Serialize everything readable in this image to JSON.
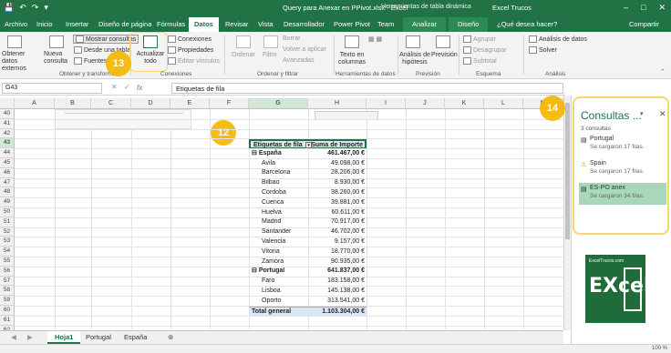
{
  "window": {
    "title": "Query para Anexar en PPivot.xlsx - Excel",
    "context_tools": "Herramientas de tabla dinámica",
    "user": "Excel Trucos"
  },
  "tabs": [
    "Archivo",
    "Inicio",
    "Insertar",
    "Diseño de página",
    "Fórmulas",
    "Datos",
    "Revisar",
    "Vista",
    "Desarrollador",
    "Power Pivot",
    "Team",
    "Analizar",
    "Diseño",
    "¿Qué desea hacer?",
    "Compartir"
  ],
  "ribbon": {
    "obtener": {
      "btn1": "Obtener datos externos",
      "btn2": "Nueva consulta",
      "items": [
        "Mostrar consultas",
        "Desde una tabla",
        "Fuentes"
      ],
      "label": "Obtener y transformar"
    },
    "conexiones": {
      "refresh": "Actualizar todo",
      "items": [
        "Conexiones",
        "Propiedades",
        "Editar vínculos"
      ],
      "label": "Conexiones"
    },
    "ordenar": {
      "sort": "Ordenar",
      "filter": "Filtro",
      "items": [
        "Borrar",
        "Volver a aplicar",
        "Avanzadas"
      ],
      "label": "Ordenar y filtrar"
    },
    "herramientas": {
      "btn": "Texto en columnas",
      "label": "Herramientas de datos"
    },
    "prevision": {
      "btn1": "Análisis de hipótesis",
      "btn2": "Previsión",
      "label": "Previsión"
    },
    "esquema": {
      "items": [
        "Agrupar",
        "Desagrupar",
        "Subtotal"
      ],
      "label": "Esquema"
    },
    "analisis": {
      "items": [
        "Análisis de datos",
        "Solver"
      ],
      "label": "Análisis"
    }
  },
  "formula_bar": {
    "cell": "G43",
    "content": "Etiquetas de fila"
  },
  "columns": [
    "A",
    "B",
    "C",
    "D",
    "E",
    "F",
    "G",
    "H",
    "I",
    "J",
    "K",
    "L",
    "M"
  ],
  "rows": [
    "40",
    "41",
    "42",
    "43",
    "44",
    "45",
    "46",
    "47",
    "48",
    "49",
    "50",
    "51",
    "52",
    "53",
    "54",
    "55",
    "56",
    "57",
    "58",
    "59",
    "60",
    "61",
    "62"
  ],
  "pivot": {
    "header_label": "Etiquetas de fila",
    "header_value": "Suma de Importe",
    "rows": [
      {
        "label": "España",
        "value": "461.467,00 €",
        "type": "group"
      },
      {
        "label": "Avila",
        "value": "49.098,00 €",
        "type": "item"
      },
      {
        "label": "Barcelona",
        "value": "28.206,00 €",
        "type": "item"
      },
      {
        "label": "Bilbao",
        "value": "8.930,00 €",
        "type": "item"
      },
      {
        "label": "Cordoba",
        "value": "38.260,00 €",
        "type": "item"
      },
      {
        "label": "Cuenca",
        "value": "39.881,00 €",
        "type": "item"
      },
      {
        "label": "Huelva",
        "value": "60.611,00 €",
        "type": "item"
      },
      {
        "label": "Madrid",
        "value": "70.917,00 €",
        "type": "item"
      },
      {
        "label": "Santander",
        "value": "46.702,00 €",
        "type": "item"
      },
      {
        "label": "Valencia",
        "value": "9.157,00 €",
        "type": "item"
      },
      {
        "label": "Vitoria",
        "value": "18.770,00 €",
        "type": "item"
      },
      {
        "label": "Zamora",
        "value": "90.935,00 €",
        "type": "item"
      },
      {
        "label": "Portugal",
        "value": "641.837,00 €",
        "type": "group"
      },
      {
        "label": "Faro",
        "value": "183.158,00 €",
        "type": "item"
      },
      {
        "label": "Lisboa",
        "value": "145.138,00 €",
        "type": "item"
      },
      {
        "label": "Oporto",
        "value": "313.541,00 €",
        "type": "item"
      }
    ],
    "total_label": "Total general",
    "total_value": "1.103.304,00 €"
  },
  "markers": {
    "m12": "12",
    "m13": "13",
    "m14": "14"
  },
  "sheets": [
    "Hoja1",
    "Portugal",
    "España"
  ],
  "queries_pane": {
    "title": "Consultas ...",
    "count": "3 consultas",
    "items": [
      {
        "name": "Portugal",
        "status": "Se cargaron 17 filas.",
        "icon": "table-icon"
      },
      {
        "name": "Spain",
        "status": "Se cargaron 17 filas.",
        "icon": "warning-icon"
      },
      {
        "name": "ES-PO anex",
        "status": "Se cargaron 34 filas.",
        "icon": "table-icon"
      }
    ]
  },
  "logo": {
    "caption": "ExcelTrucos.com",
    "letters": "EXcel"
  },
  "status": {
    "zoom": "100 %"
  }
}
